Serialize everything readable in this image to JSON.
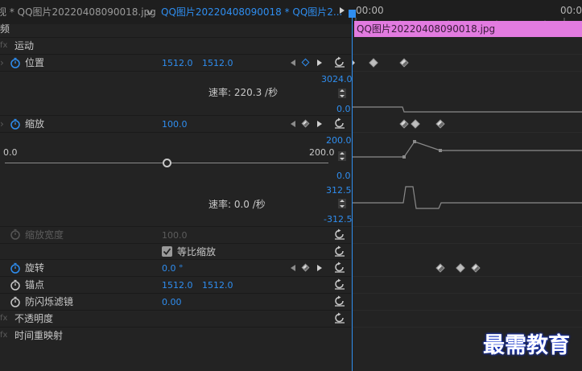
{
  "header": {
    "source_tab": "视 * QQ图片20220408090018.jpg",
    "seq_tab": "QQ图片20220408090018 * QQ图片2...",
    "timecode_start": "00:00",
    "timecode_end": "00:00",
    "clip_name": "QQ图片20220408090018.jpg"
  },
  "sections": {
    "video": "频",
    "motion": "运动",
    "opacity": "不透明度",
    "time_remap": "时间重映射"
  },
  "position": {
    "label": "位置",
    "x": "1512.0",
    "y": "1512.0",
    "graph_max": "3024.0",
    "graph_min": "0.0",
    "rate_label": "速率: 220.3 /秒"
  },
  "scale": {
    "label": "缩放",
    "value": "100.0",
    "graph_max": "200.0",
    "graph_min": "0.0",
    "slider_min": "0.0",
    "slider_max": "200.0",
    "slider_value": 50,
    "vel_max": "312.5",
    "vel_min": "-312.5",
    "rate_label": "速率: 0.0 /秒"
  },
  "scale_width": {
    "label": "缩放宽度",
    "value": "100.0"
  },
  "uniform_scale": {
    "label": "等比缩放",
    "checked": true
  },
  "rotation": {
    "label": "旋转",
    "value": "0.0 °"
  },
  "anchor": {
    "label": "锚点",
    "x": "1512.0",
    "y": "1512.0"
  },
  "flicker": {
    "label": "防闪烁滤镜",
    "value": "0.00"
  },
  "watermark": "最需教育",
  "colors": {
    "accent_blue": "#2f8ef0",
    "clip_pink": "#e27be0",
    "playhead": "#2f8ef0",
    "background": "#232323"
  }
}
